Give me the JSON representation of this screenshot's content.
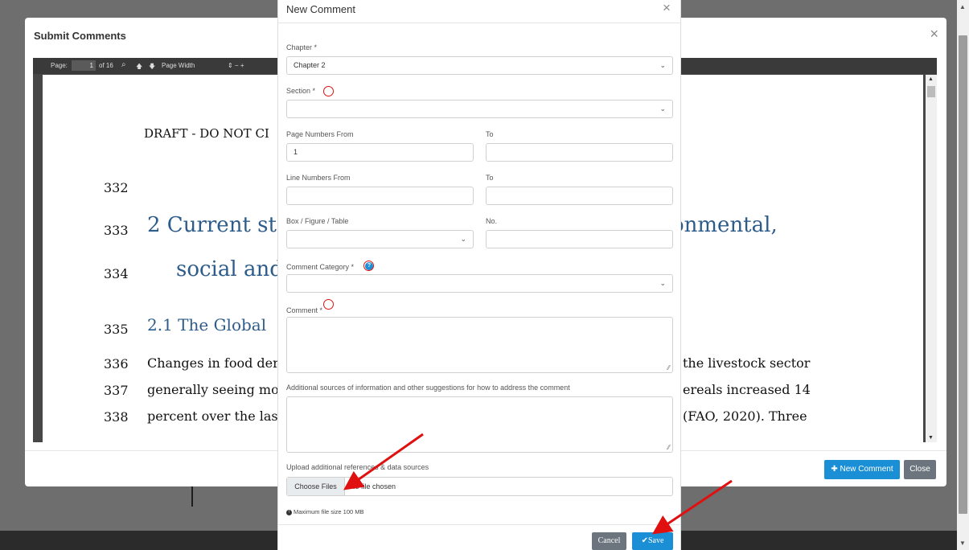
{
  "submit_modal": {
    "title": "Submit Comments",
    "close_glyph": "×",
    "new_comment_label": "New Comment",
    "close_label": "Close"
  },
  "pdf": {
    "toolbar": {
      "page_label": "Page:",
      "page_value": "1",
      "of_label": "of 16",
      "zoom_label": "Page Width",
      "zoom_ops": "⇕  −  +"
    },
    "lines": [
      {
        "num": "",
        "text": "DRAFT - DO NOT CI"
      },
      {
        "num": "332",
        "text": ""
      },
      {
        "num": "333",
        "text": "2   Current st"
      },
      {
        "num": "334",
        "text": "social and"
      },
      {
        "num": "335",
        "text": "2.1   The Global"
      },
      {
        "num": "336",
        "text": "Changes in food der"
      },
      {
        "num": "337",
        "text": "generally seeing mo"
      },
      {
        "num": "338",
        "text": "percent over the las"
      }
    ],
    "right_fragments": {
      "l333": "onmental,",
      "l336": "the livestock sector",
      "l337": "ereals increased 14",
      "l338": "(FAO, 2020). Three"
    }
  },
  "new_comment": {
    "title": "New Comment",
    "close_glyph": "×",
    "chapter": {
      "label": "Chapter *",
      "value": "Chapter 2"
    },
    "section": {
      "label": "Section *",
      "value": ""
    },
    "page_from": {
      "label": "Page Numbers From",
      "value": "1"
    },
    "page_to": {
      "label": "To",
      "value": ""
    },
    "line_from": {
      "label": "Line Numbers From",
      "value": ""
    },
    "line_to": {
      "label": "To",
      "value": ""
    },
    "box_figure": {
      "label": "Box / Figure / Table",
      "value": ""
    },
    "box_no": {
      "label": "No.",
      "value": ""
    },
    "category": {
      "label": "Comment Category *",
      "value": ""
    },
    "comment": {
      "label": "Comment *"
    },
    "additional": {
      "label": "Additional sources of information and other suggestions for how to address the comment"
    },
    "upload": {
      "label": "Upload additional references & data sources",
      "button": "Choose Files",
      "status": "No file chosen"
    },
    "max_size_note": "Maximum file size 100 MB",
    "cancel_label": "Cancel",
    "save_label": "Save"
  },
  "colors": {
    "primary": "#1b8fd6",
    "secondary": "#6c757d",
    "annotation_red": "#e01010",
    "heading_blue": "#2e5c8a"
  }
}
